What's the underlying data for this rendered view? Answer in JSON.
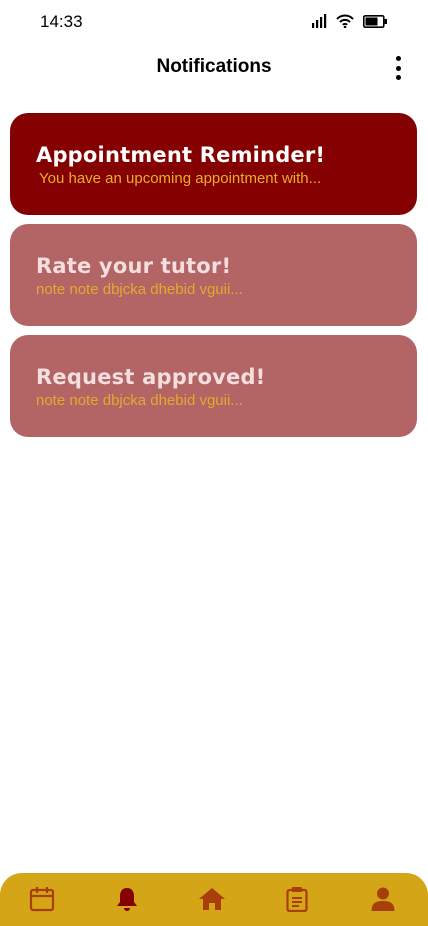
{
  "status_bar": {
    "time": "14:33"
  },
  "header": {
    "title": "Notifications",
    "menu_icon": "more-vertical-icon"
  },
  "notifications": [
    {
      "title": "Appointment Reminder!",
      "body": "You have an upcoming appointment with...",
      "state": "unread"
    },
    {
      "title": "Rate your tutor!",
      "body": "note note dbjcka dhebid vguii...",
      "state": "read"
    },
    {
      "title": "Request approved!",
      "body": "note note dbjcka dhebid vguii...",
      "state": "read"
    }
  ],
  "bottom_nav": {
    "items": [
      {
        "icon": "calendar-icon",
        "active": false
      },
      {
        "icon": "bell-icon",
        "active": true
      },
      {
        "icon": "home-icon",
        "active": false
      },
      {
        "icon": "clipboard-icon",
        "active": false
      },
      {
        "icon": "profile-icon",
        "active": false
      }
    ]
  },
  "colors": {
    "accent_dark_red": "#850000",
    "faded_red": "#b36464",
    "gold": "#d4a516",
    "nav_icon": "#a83f0a",
    "nav_active": "#850000"
  }
}
